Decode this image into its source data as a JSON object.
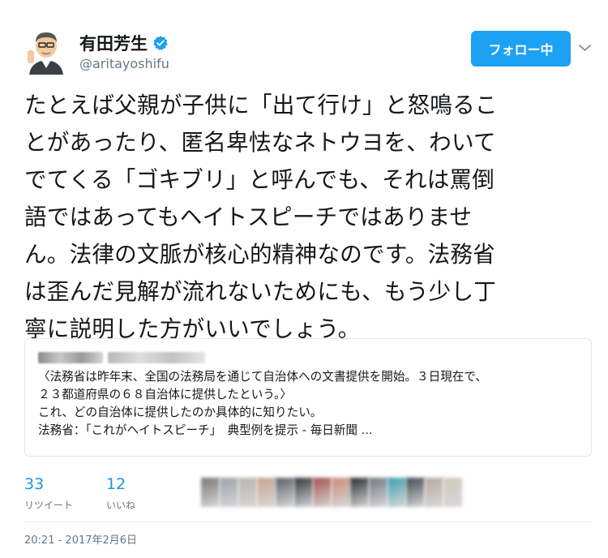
{
  "user": {
    "display_name": "有田芳生",
    "handle": "@aritayoshifu",
    "verified_icon": "verified-badge-icon"
  },
  "follow_button_label": "フォロー中",
  "tweet_lines": [
    "たとえば父親が子供に「出て行け」と怒鳴るこ",
    "とがあったり、匿名卑怯なネトウヨを、わいて",
    "でてくる「ゴキブリ」と呼んでも、それは罵倒",
    "語ではあってもヘイトスピーチではありませ",
    "ん。法律の文脈が核心的精神なのです。法務省",
    "は歪んだ見解が流れないためにも、もう少し丁",
    "寧に説明した方がいいでしょう。"
  ],
  "quote": {
    "lines": [
      "〈法務省は昨年末、全国の法務局を通じて自治体への文書提供を開始。３日現在で、",
      "２３都道府県の６８自治体に提供したという。〉",
      "これ、どの自治体に提供したのか具体的に知りたい。",
      "法務省：「これがヘイトスピーチ」　典型例を提示 - 毎日新聞 ..."
    ]
  },
  "stats": {
    "retweets_count": "33",
    "retweets_label": "リツイート",
    "likes_count": "12",
    "likes_label": "いいね"
  },
  "liker_colors": [
    "#7a7570",
    "#9aa0a8",
    "#b8b3ad",
    "#c9a38d",
    "#5a6068",
    "#303438",
    "#a0504a",
    "#c98a7a",
    "#2a2e32",
    "#707880",
    "#3aa0b0",
    "#404850",
    "#b8a8a0",
    "#d0c8b8"
  ],
  "timestamp": "20:21 - 2017年2月6日"
}
